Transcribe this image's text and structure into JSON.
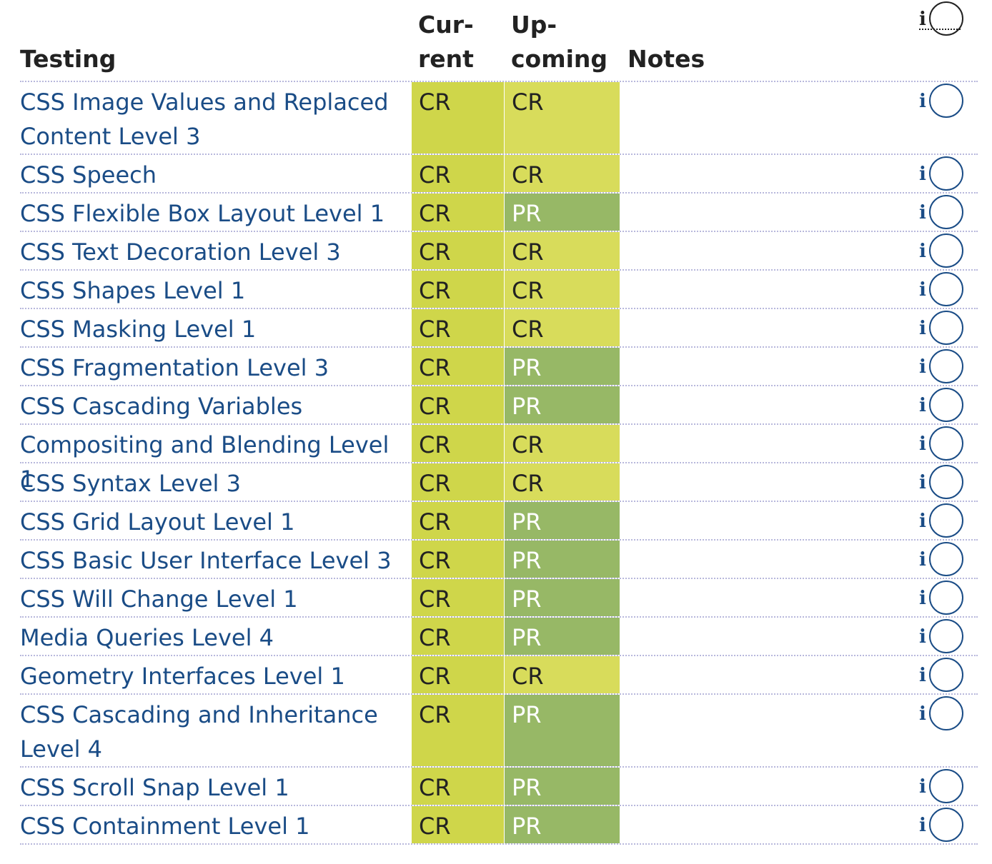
{
  "headers": {
    "testing": "Testing",
    "current_line1": "Cur-",
    "current_line2": "rent",
    "upcoming_line1": "Up-",
    "upcoming_line2": "coming",
    "notes": "Notes",
    "info": "i"
  },
  "colors": {
    "current_cell": "#cfd64a",
    "cr_cell": "#d8dc5b",
    "pr_cell": "#97b866",
    "link": "#1a4c86"
  },
  "rows": [
    {
      "name_line1": "CSS Image Values and Replaced",
      "name_line2": "Content Level 3",
      "current": "CR",
      "upcoming": "CR",
      "info": "i"
    },
    {
      "name_line1": "CSS Speech",
      "current": "CR",
      "upcoming": "CR",
      "info": "i"
    },
    {
      "name_line1": "CSS Flexible Box Layout Level 1",
      "current": "CR",
      "upcoming": "PR",
      "info": "i"
    },
    {
      "name_line1": "CSS Text Decoration Level 3",
      "current": "CR",
      "upcoming": "CR",
      "info": "i"
    },
    {
      "name_line1": "CSS Shapes Level 1",
      "current": "CR",
      "upcoming": "CR",
      "info": "i"
    },
    {
      "name_line1": "CSS Masking Level 1",
      "current": "CR",
      "upcoming": "CR",
      "info": "i"
    },
    {
      "name_line1": "CSS Fragmentation Level 3",
      "current": "CR",
      "upcoming": "PR",
      "info": "i"
    },
    {
      "name_line1": "CSS Cascading Variables",
      "current": "CR",
      "upcoming": "PR",
      "info": "i"
    },
    {
      "name_line1": "Compositing and Blending Level 1",
      "current": "CR",
      "upcoming": "CR",
      "info": "i"
    },
    {
      "name_line1": "CSS Syntax Level 3",
      "current": "CR",
      "upcoming": "CR",
      "info": "i"
    },
    {
      "name_line1": "CSS Grid Layout Level 1",
      "current": "CR",
      "upcoming": "PR",
      "info": "i"
    },
    {
      "name_line1": "CSS Basic User Interface Level 3",
      "current": "CR",
      "upcoming": "PR",
      "info": "i"
    },
    {
      "name_line1": "CSS Will Change Level 1",
      "current": "CR",
      "upcoming": "PR",
      "info": "i"
    },
    {
      "name_line1": "Media Queries Level 4",
      "current": "CR",
      "upcoming": "PR",
      "info": "i"
    },
    {
      "name_line1": "Geometry Interfaces Level 1",
      "current": "CR",
      "upcoming": "CR",
      "info": "i"
    },
    {
      "name_line1": "CSS Cascading and Inheritance",
      "name_line2": "Level 4",
      "current": "CR",
      "upcoming": "PR",
      "info": "i"
    },
    {
      "name_line1": "CSS Scroll Snap Level 1",
      "current": "CR",
      "upcoming": "PR",
      "info": "i"
    },
    {
      "name_line1": "CSS Containment Level 1",
      "current": "CR",
      "upcoming": "PR",
      "info": "i"
    }
  ]
}
